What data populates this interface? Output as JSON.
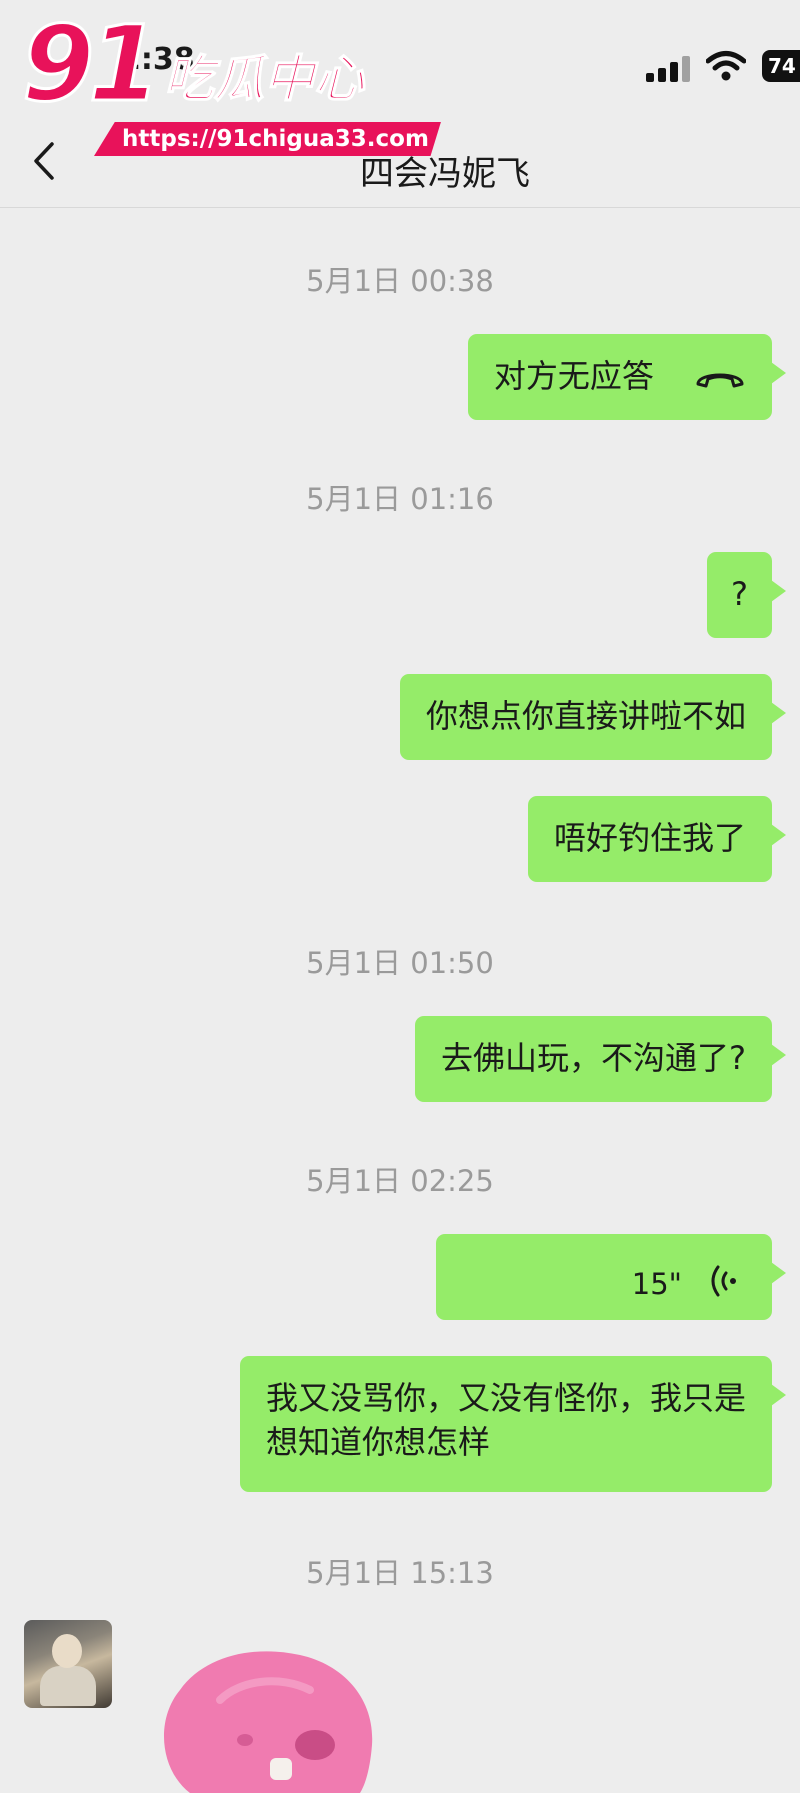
{
  "watermark": {
    "number": "91",
    "title": "吃瓜中心",
    "url": "https://91chigua33.com",
    "color": "#e8125a"
  },
  "status_bar": {
    "time": "2:38",
    "battery": "74"
  },
  "nav": {
    "back_icon": "chevron-left-icon",
    "title": "四会冯妮飞"
  },
  "messages": [
    {
      "type": "timestamp",
      "text": "5月1日 00:38"
    },
    {
      "type": "call",
      "side": "right",
      "text": "对方无应答",
      "icon": "phone-hangup-icon"
    },
    {
      "type": "timestamp",
      "text": "5月1日 01:16"
    },
    {
      "type": "text",
      "side": "right",
      "text": "?"
    },
    {
      "type": "text",
      "side": "right",
      "text": "你想点你直接讲啦不如"
    },
    {
      "type": "text",
      "side": "right",
      "text": "唔好钓住我了"
    },
    {
      "type": "timestamp",
      "text": "5月1日 01:50"
    },
    {
      "type": "text",
      "side": "right",
      "text": "去佛山玩，不沟通了?"
    },
    {
      "type": "timestamp",
      "text": "5月1日 02:25"
    },
    {
      "type": "voice",
      "side": "right",
      "duration": "15\"",
      "icon": "voice-wave-icon"
    },
    {
      "type": "text",
      "side": "right",
      "text": "我又没骂你，又没有怪你，我只是\n想知道你想怎样"
    },
    {
      "type": "timestamp",
      "text": "5月1日 15:13"
    },
    {
      "type": "sticker",
      "side": "left",
      "icon": "pink-blob-sticker-icon"
    }
  ],
  "colors": {
    "background": "#ededed",
    "bubble_outgoing": "#95ec69",
    "timestamp": "#9a9a9a"
  }
}
